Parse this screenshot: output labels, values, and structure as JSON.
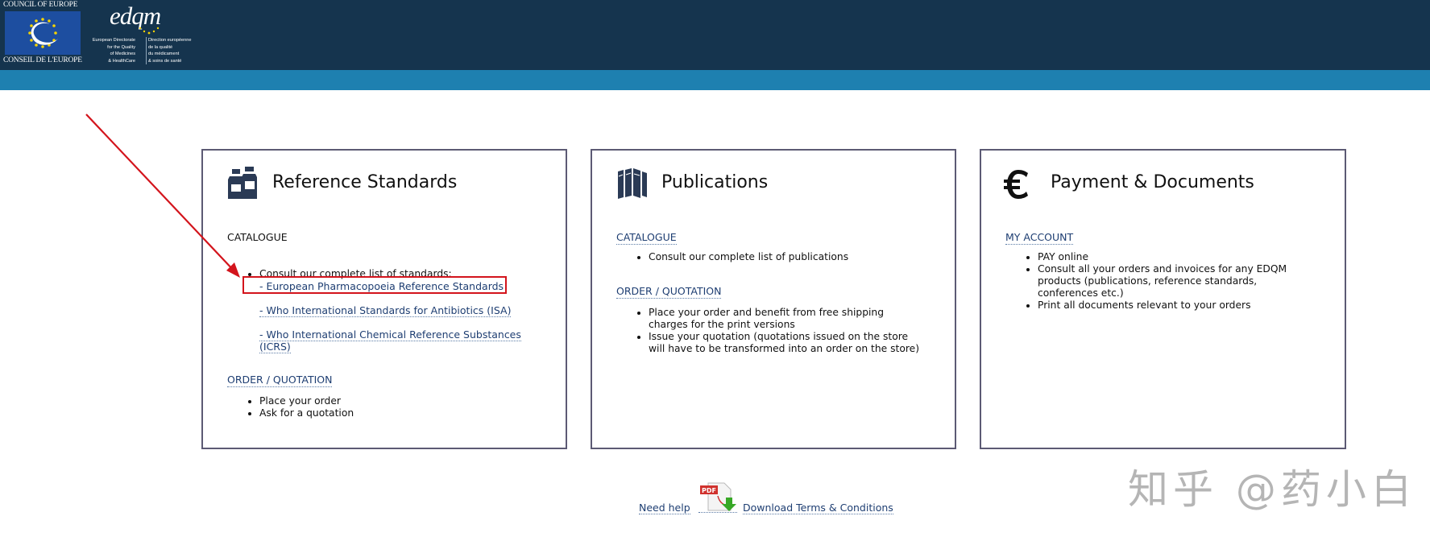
{
  "header": {
    "coe_top": "COUNCIL OF EUROPE",
    "coe_bottom": "CONSEIL DE L'EUROPE",
    "edqm_logo": "edqm",
    "edqm_en": "European Directorate\nfor the Quality\nof Medicines\n& HealthCare",
    "edqm_fr": "Direction européenne\nde la qualité\ndu médicament\n& soins de santé",
    "colors": {
      "header_bg": "#15344e",
      "subbar_bg": "#1e80b0"
    }
  },
  "panels": {
    "reference": {
      "title": "Reference Standards",
      "icon": "bottles-icon",
      "catalogue_label": "CATALOGUE",
      "catalogue_intro": "Consult our complete list of standards:",
      "catalogue_links": [
        "- European Pharmacopoeia Reference Standards",
        "- Who International Standards for Antibiotics (ISA)",
        "- Who International Chemical Reference Substances (ICRS)"
      ],
      "order_label": "ORDER / QUOTATION",
      "order_items": [
        "Place your order",
        "Ask for a quotation"
      ]
    },
    "publications": {
      "title": "Publications",
      "icon": "books-icon",
      "catalogue_label": "CATALOGUE",
      "catalogue_items": [
        "Consult our complete list of publications"
      ],
      "order_label": "ORDER / QUOTATION",
      "order_items": [
        "Place your order and benefit from free shipping charges for the print versions",
        "Issue your quotation (quotations issued on the store will have to be transformed into an order on the store)"
      ]
    },
    "payment": {
      "title": "Payment & Documents",
      "icon": "euro-icon",
      "account_label": "MY ACCOUNT",
      "account_items": [
        "PAY online",
        "Consult all your orders and invoices for any EDQM products (publications, reference standards, conferences etc.)",
        "Print all documents relevant to your orders"
      ]
    }
  },
  "footer": {
    "help": "Need help",
    "download": "Download Terms & Conditions",
    "pdf_badge": "PDF"
  },
  "annotation": {
    "highlight_color": "#d3141c"
  },
  "watermark": "知乎 @药小白"
}
